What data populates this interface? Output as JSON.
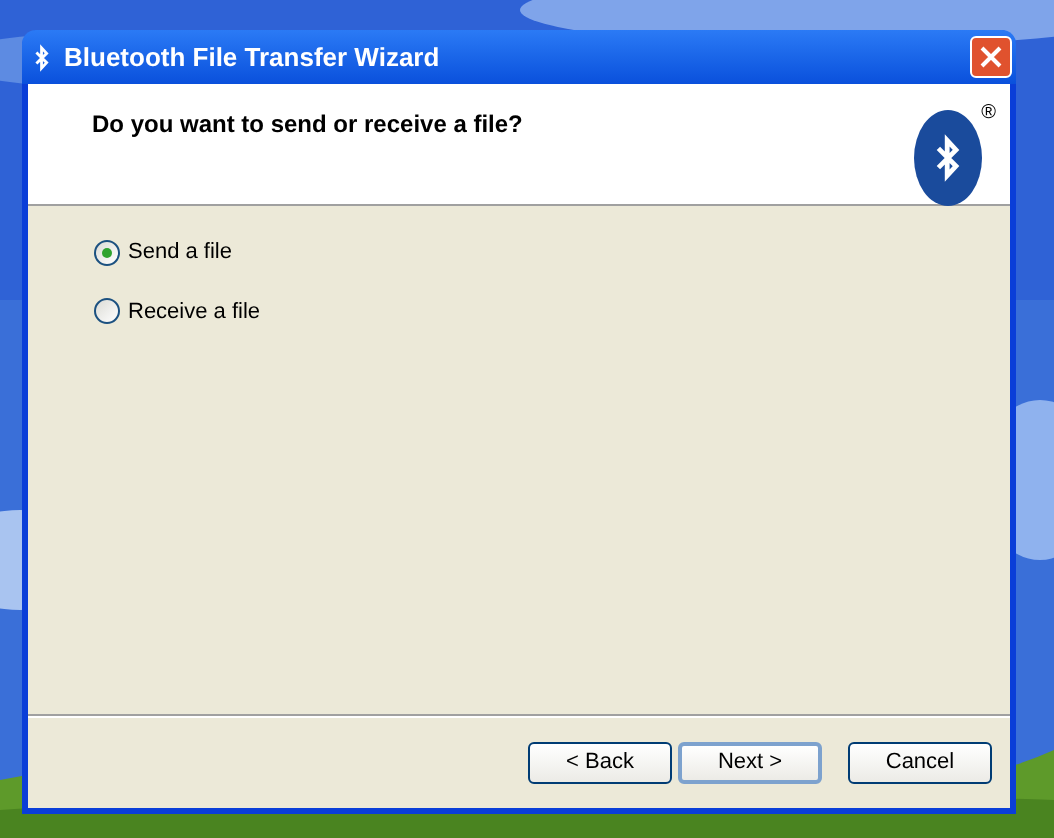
{
  "window": {
    "title": "Bluetooth File Transfer Wizard"
  },
  "header": {
    "question": "Do you want to send or receive a file?",
    "logo_mark": "®"
  },
  "options": [
    {
      "label": "Send a file",
      "selected": true
    },
    {
      "label": "Receive a file",
      "selected": false
    }
  ],
  "buttons": [
    {
      "label": "< Back",
      "default": false
    },
    {
      "label": "Next >",
      "default": true
    },
    {
      "label": "Cancel",
      "default": false
    }
  ]
}
